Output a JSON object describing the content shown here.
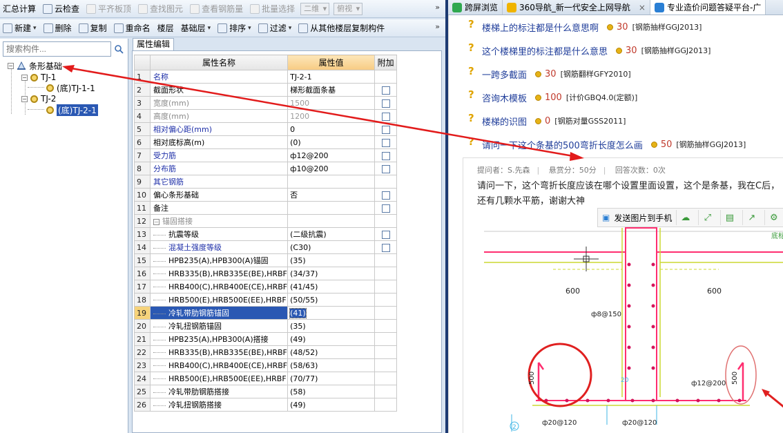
{
  "toolbar1": {
    "items": [
      {
        "label": "汇总计算",
        "icon": "calc-icon",
        "disabled": false
      },
      {
        "label": "云检查",
        "icon": "cloud-check-icon",
        "disabled": false
      },
      {
        "label": "平齐板顶",
        "icon": "align-top-icon",
        "disabled": true
      },
      {
        "label": "查找图元",
        "icon": "find-element-icon",
        "disabled": true
      },
      {
        "label": "查看钢筋量",
        "icon": "rebar-quantity-icon",
        "disabled": true
      },
      {
        "label": "批量选择",
        "icon": "batch-select-icon",
        "disabled": true
      }
    ],
    "view_2d": "二维",
    "view_top": "俯视"
  },
  "toolbar2": {
    "items": [
      {
        "label": "新建",
        "icon": "new-icon",
        "dropdown": true
      },
      {
        "label": "删除",
        "icon": "delete-icon"
      },
      {
        "label": "复制",
        "icon": "copy-icon"
      },
      {
        "label": "重命名",
        "icon": "rename-icon"
      },
      {
        "label": "楼层",
        "icon": ""
      },
      {
        "label": "基础层",
        "icon": "",
        "dropdown": true
      },
      {
        "label": "排序",
        "icon": "sort-icon",
        "dropdown": true
      },
      {
        "label": "过滤",
        "icon": "filter-icon",
        "dropdown": true
      },
      {
        "label": "从其他楼层复制构件",
        "icon": "copy-floor-icon"
      }
    ]
  },
  "search": {
    "placeholder": "搜索构件..."
  },
  "tree": {
    "root": "条形基础",
    "nodes": [
      {
        "label": "TJ-1"
      },
      {
        "label": "(底)TJ-1-1"
      },
      {
        "label": "TJ-2"
      },
      {
        "label": "(底)TJ-2-1"
      }
    ]
  },
  "props": {
    "tab": "属性编辑",
    "headers": {
      "name": "属性名称",
      "value": "属性值",
      "extra": "附加"
    },
    "rows": [
      {
        "n": "1",
        "name": "名称",
        "value": "TJ-2-1",
        "style": "blue",
        "chk": false
      },
      {
        "n": "2",
        "name": "截面形状",
        "value": "梯形截面条基",
        "style": "",
        "chk": true
      },
      {
        "n": "3",
        "name": "宽度(mm)",
        "value": "1500",
        "style": "gray",
        "chk": true
      },
      {
        "n": "4",
        "name": "高度(mm)",
        "value": "1200",
        "style": "gray",
        "chk": true
      },
      {
        "n": "5",
        "name": "相对偏心距(mm)",
        "value": "0",
        "style": "blue",
        "chk": true
      },
      {
        "n": "6",
        "name": "相对底标高(m)",
        "value": "(0)",
        "style": "",
        "chk": true
      },
      {
        "n": "7",
        "name": "受力筋",
        "value": "ф12@200",
        "style": "blue",
        "chk": true
      },
      {
        "n": "8",
        "name": "分布筋",
        "value": "ф10@200",
        "style": "blue",
        "chk": true
      },
      {
        "n": "9",
        "name": "其它钢筋",
        "value": "",
        "style": "blue",
        "chk": false
      },
      {
        "n": "10",
        "name": "偏心条形基础",
        "value": "否",
        "style": "",
        "chk": true
      },
      {
        "n": "11",
        "name": "备注",
        "value": "",
        "style": "",
        "chk": true
      },
      {
        "n": "12",
        "name": "锚固搭接",
        "value": "",
        "style": "group",
        "chk": false
      },
      {
        "n": "13",
        "name": "抗震等级",
        "value": "(二级抗震)",
        "style": "indent",
        "chk": true
      },
      {
        "n": "14",
        "name": "混凝土强度等级",
        "value": "(C30)",
        "style": "indent-blue",
        "chk": true
      },
      {
        "n": "15",
        "name": "HPB235(A),HPB300(A)锚固",
        "value": "(35)",
        "style": "indent",
        "chk": false
      },
      {
        "n": "16",
        "name": "HRB335(B),HRB335E(BE),HRBF",
        "value": "(34/37)",
        "style": "indent",
        "chk": false
      },
      {
        "n": "17",
        "name": "HRB400(C),HRB400E(CE),HRBF",
        "value": "(41/45)",
        "style": "indent",
        "chk": false
      },
      {
        "n": "18",
        "name": "HRB500(E),HRB500E(EE),HRBF",
        "value": "(50/55)",
        "style": "indent",
        "chk": false
      },
      {
        "n": "19",
        "name": "冷轧带肋钢筋锚固",
        "value": "(41)",
        "style": "indent",
        "chk": false,
        "selected": true
      },
      {
        "n": "20",
        "name": "冷轧扭钢筋锚固",
        "value": "(35)",
        "style": "indent",
        "chk": false
      },
      {
        "n": "21",
        "name": "HPB235(A),HPB300(A)搭接",
        "value": "(49)",
        "style": "indent",
        "chk": false
      },
      {
        "n": "22",
        "name": "HRB335(B),HRB335E(BE),HRBF",
        "value": "(48/52)",
        "style": "indent",
        "chk": false
      },
      {
        "n": "23",
        "name": "HRB400(C),HRB400E(CE),HRBF",
        "value": "(58/63)",
        "style": "indent",
        "chk": false
      },
      {
        "n": "24",
        "name": "HRB500(E),HRB500E(EE),HRBF",
        "value": "(70/77)",
        "style": "indent",
        "chk": false
      },
      {
        "n": "25",
        "name": "冷轧带肋钢筋搭接",
        "value": "(58)",
        "style": "indent",
        "chk": false
      },
      {
        "n": "26",
        "name": "冷轧扭钢筋搭接",
        "value": "(49)",
        "style": "indent",
        "chk": false
      }
    ]
  },
  "browser": {
    "tabs": [
      {
        "label": "跨屏浏览",
        "color": "#2fa84f",
        "active": false,
        "closable": false
      },
      {
        "label": "360导航_新一代安全上网导航",
        "color": "#f0b400",
        "active": false,
        "closable": true
      },
      {
        "label": "专业造价问题答疑平台-广",
        "color": "#2a7fd4",
        "active": true,
        "closable": false
      }
    ],
    "questions": [
      {
        "title": "楼梯上的标注都是什么意思啊",
        "score": "30",
        "tag": "[钢筋抽样GGJ2013]"
      },
      {
        "title": "这个楼梯里的标注都是什么意思",
        "score": "30",
        "tag": "[钢筋抽样GGJ2013]"
      },
      {
        "title": "一跨多截面",
        "score": "30",
        "tag": "[钢筋翻样GFY2010]"
      },
      {
        "title": "咨询木模板",
        "score": "100",
        "tag": "[计价GBQ4.0(定额)]"
      },
      {
        "title": "楼梯的识图",
        "score": "0",
        "tag": "[钢筋对量GSS2011]"
      },
      {
        "title": "请问一下这个条基的500弯折长度怎么画",
        "score": "50",
        "tag": "[钢筋抽样GGJ2013]"
      }
    ],
    "detail": {
      "asker": "提问者：S.先森",
      "reward": "悬赏分：50分",
      "answers": "回答次数：0次",
      "text": "请问一下，这个弯折长度应该在哪个设置里面设置，这个是条基，我在C后，还有几颗水平筋，谢谢大神",
      "send_to_phone": "发送图片到手机"
    },
    "drawing_labels": {
      "dim_left": "600",
      "dim_right": "600",
      "stirrup": "ф8@150",
      "hook_left": "500",
      "hook_right": "500",
      "rebar_right": "ф12@200",
      "bottom_left": "ф20@120",
      "bottom_mid": "ф20@120",
      "mark_20": "20",
      "circle_num": "2",
      "corner_text": "底标"
    }
  }
}
